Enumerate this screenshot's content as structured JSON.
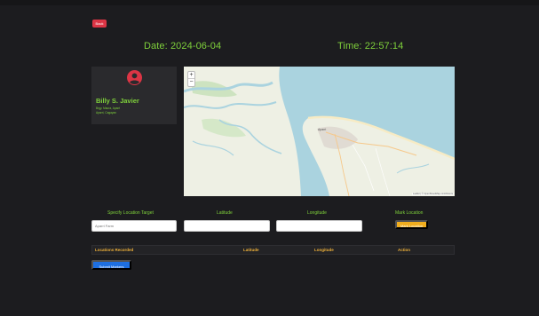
{
  "header": {
    "back_label": "Back",
    "date_text": "Date: 2024-06-04",
    "time_text": "Time: 22:57:14"
  },
  "profile": {
    "icon": "user-circle-icon",
    "name": "Billy S. Javier",
    "line1": "Aparri, Cagayan",
    "line2": "Brgy. Maura, Aparri"
  },
  "map": {
    "zoom_in": "+",
    "zoom_out": "−",
    "place_label": "Aparri",
    "attribution": "Leaflet | © OpenStreetMap contributors"
  },
  "form": {
    "target_label": "Specify Location Target",
    "target_placeholder": "Aparri Farm",
    "latitude_label": "Latitude",
    "longitude_label": "Longitude",
    "mark_label": "Mark Location",
    "mark_button": "Mark Location"
  },
  "table": {
    "headers": [
      "Locations Recorded",
      "Latitude",
      "Longitude",
      "Action"
    ]
  },
  "actions": {
    "submit_label": "Submit Markers"
  },
  "colors": {
    "accent_green": "#7fd13b",
    "header_orange": "#f0b23a",
    "danger": "#dc3545",
    "warning": "#f0ad1e",
    "primary": "#1e6fe0"
  }
}
